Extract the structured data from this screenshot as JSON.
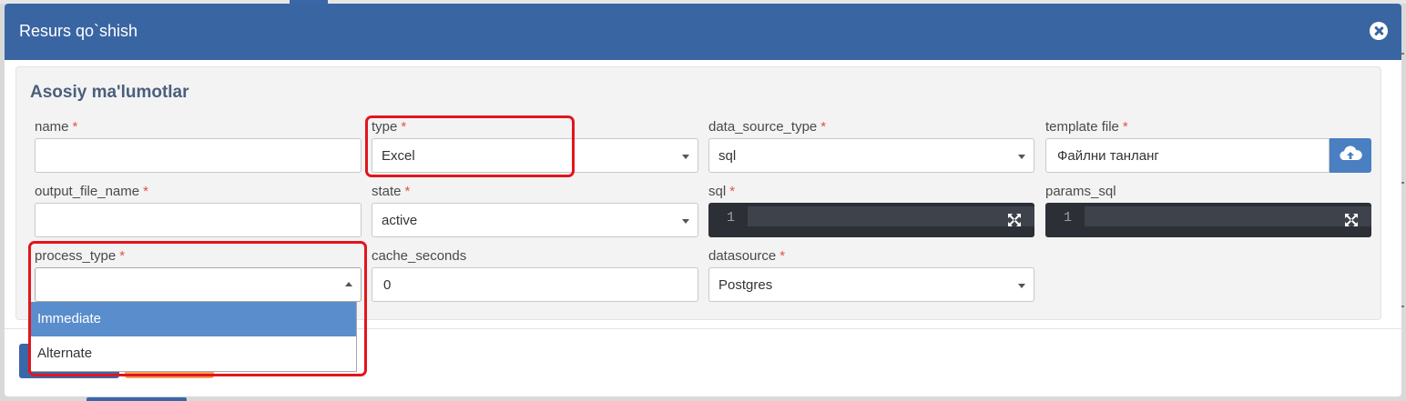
{
  "modal": {
    "title": "Resurs qo`shish",
    "section_title": "Asosiy ma'lumotlar"
  },
  "fields": {
    "name": {
      "label": "name",
      "required": "*",
      "value": "",
      "placeholder": ""
    },
    "type": {
      "label": "type",
      "required": "*",
      "value": "Excel"
    },
    "data_source_type": {
      "label": "data_source_type",
      "required": "*",
      "value": "sql"
    },
    "template_file": {
      "label": "template file",
      "required": "*",
      "value": "Файлни танланг"
    },
    "output_file_name": {
      "label": "output_file_name",
      "required": "*",
      "value": "",
      "placeholder": ""
    },
    "state": {
      "label": "state",
      "required": "*",
      "value": "active"
    },
    "sql": {
      "label": "sql",
      "required": "*",
      "line_number": "1"
    },
    "params_sql": {
      "label": "params_sql",
      "line_number": "1"
    },
    "process_type": {
      "label": "process_type",
      "required": "*",
      "value": "",
      "options": [
        "Immediate",
        "Alternate"
      ],
      "highlighted_option": "Immediate"
    },
    "cache_seconds": {
      "label": "cache_seconds",
      "value": "0"
    },
    "datasource": {
      "label": "datasource",
      "required": "*",
      "value": "Postgres"
    }
  },
  "icons": {
    "close": "close-circle-icon",
    "upload": "cloud-upload-icon",
    "expand": "fullscreen-expand-icon",
    "select_caret": "chevron-down-icon"
  },
  "colors": {
    "header": "#3a65a3",
    "highlight_option": "#5a8dcc",
    "annotation": "#e3151c",
    "code_bg": "#2c2f36",
    "required": "#e2514c"
  }
}
